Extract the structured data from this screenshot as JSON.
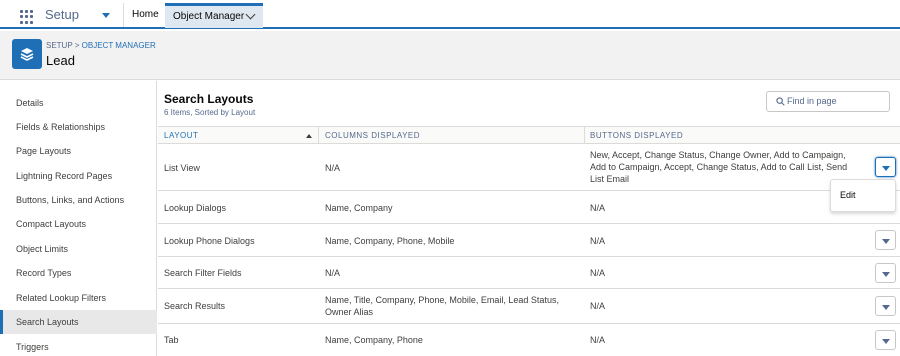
{
  "topbar": {
    "app_name": "Setup",
    "home_label": "Home",
    "active_tab_label": "Object Manager"
  },
  "header": {
    "crumb_setup": "SETUP",
    "crumb_sep": ">",
    "crumb_object_manager": "OBJECT MANAGER",
    "title": "Lead"
  },
  "sidebar": {
    "items": [
      {
        "label": "Details"
      },
      {
        "label": "Fields & Relationships"
      },
      {
        "label": "Page Layouts"
      },
      {
        "label": "Lightning Record Pages"
      },
      {
        "label": "Buttons, Links, and Actions"
      },
      {
        "label": "Compact Layouts"
      },
      {
        "label": "Object Limits"
      },
      {
        "label": "Record Types"
      },
      {
        "label": "Related Lookup Filters"
      },
      {
        "label": "Search Layouts"
      },
      {
        "label": "Triggers"
      }
    ],
    "active": "Search Layouts"
  },
  "main": {
    "title": "Search Layouts",
    "subtitle": "6 Items, Sorted by Layout",
    "search_placeholder": "Find in page",
    "columns": [
      "LAYOUT",
      "COLUMNS DISPLAYED",
      "BUTTONS DISPLAYED"
    ],
    "rows": [
      {
        "layout": "List View",
        "columns": "N/A",
        "buttons": "New, Accept, Change Status, Change Owner, Add to Campaign, Add to Campaign, Accept, Change Status, Add to Call List, Send List Email"
      },
      {
        "layout": "Lookup Dialogs",
        "columns": "Name, Company",
        "buttons": "N/A"
      },
      {
        "layout": "Lookup Phone Dialogs",
        "columns": "Name, Company, Phone, Mobile",
        "buttons": "N/A"
      },
      {
        "layout": "Search Filter Fields",
        "columns": "N/A",
        "buttons": "N/A"
      },
      {
        "layout": "Search Results",
        "columns": "Name, Title, Company, Phone, Mobile, Email, Lead Status, Owner Alias",
        "buttons": "N/A"
      },
      {
        "layout": "Tab",
        "columns": "Name, Company, Phone",
        "buttons": "N/A"
      }
    ],
    "row_menu": {
      "items": [
        "Edit"
      ]
    }
  },
  "colors": {
    "brand": "#1f6fb6",
    "header_bg": "#f3f2f2",
    "active_tab_bg": "#dfe7f0"
  }
}
